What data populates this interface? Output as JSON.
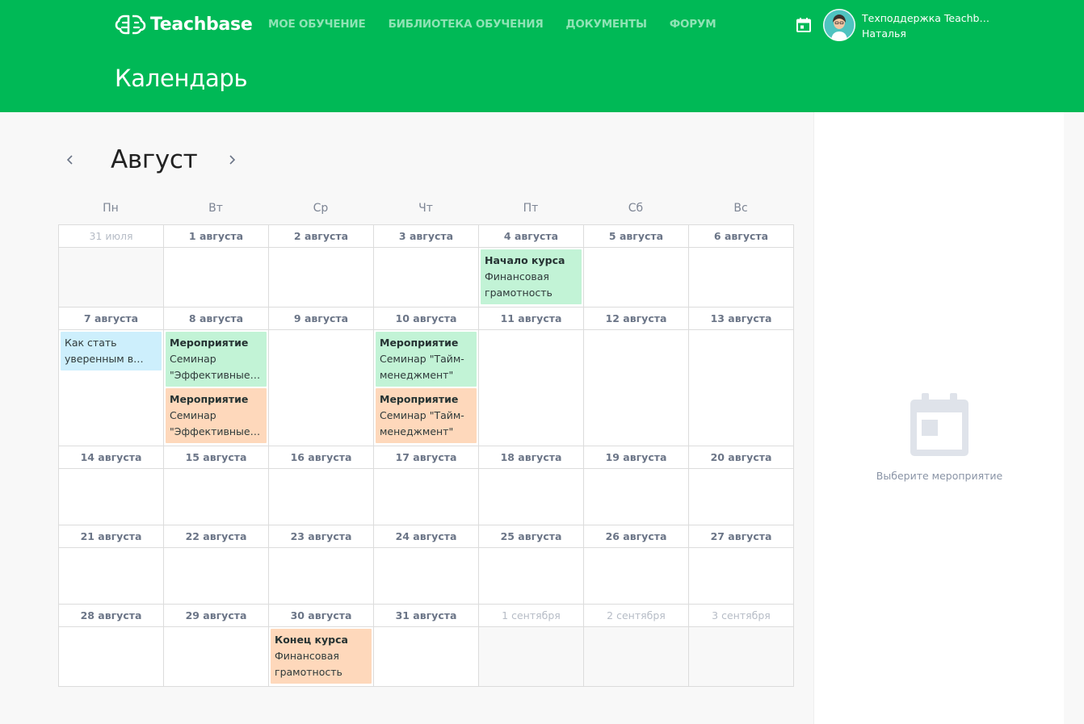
{
  "app": {
    "logo_text": "Teachbase",
    "brand_color": "#00b956"
  },
  "nav": [
    {
      "label": "МОЕ ОБУЧЕНИЕ"
    },
    {
      "label": "БИБЛИОТЕКА ОБУЧЕНИЯ"
    },
    {
      "label": "ДОКУМЕНТЫ"
    },
    {
      "label": "ФОРУМ"
    }
  ],
  "user": {
    "line1": "Техподдержка Teachbase",
    "line2": "Наталья"
  },
  "page": {
    "title": "Календарь"
  },
  "calendar": {
    "month": "Август",
    "weekdays": [
      "Пн",
      "Вт",
      "Ср",
      "Чт",
      "Пт",
      "Сб",
      "Вс"
    ],
    "weeks": [
      {
        "dates": [
          "31 июля",
          "1 августа",
          "2 августа",
          "3 августа",
          "4 августа",
          "5 августа",
          "6 августа"
        ],
        "events": {
          "4": [
            {
              "title": "Начало курса",
              "desc": "Финансовая грамотность",
              "color": "green"
            }
          ]
        }
      },
      {
        "dates": [
          "7 августа",
          "8 августа",
          "9 августа",
          "10 августа",
          "11 августа",
          "12 августа",
          "13 августа"
        ],
        "events": {
          "0": [
            {
              "title": "",
              "desc": "Как стать уверенным в себе",
              "color": "blue"
            }
          ],
          "1": [
            {
              "title": "Мероприятие",
              "desc": "Семинар \"Эффективные переговоры\"",
              "color": "green"
            },
            {
              "title": "Мероприятие",
              "desc": "Семинар \"Эффективные переговоры\"",
              "color": "orange"
            }
          ],
          "3": [
            {
              "title": "Мероприятие",
              "desc": "Семинар \"Тайм-менеджмент\"",
              "color": "green"
            },
            {
              "title": "Мероприятие",
              "desc": "Семинар \"Тайм-менеджмент\"",
              "color": "orange"
            }
          ]
        }
      },
      {
        "dates": [
          "14 августа",
          "15 августа",
          "16 августа",
          "17 августа",
          "18 августа",
          "19 августа",
          "20 августа"
        ],
        "events": {}
      },
      {
        "dates": [
          "21 августа",
          "22 августа",
          "23 августа",
          "24 августа",
          "25 августа",
          "26 августа",
          "27 августа"
        ],
        "events": {}
      },
      {
        "dates": [
          "28 августа",
          "29 августа",
          "30 августа",
          "31 августа",
          "1 сентября",
          "2 сентября",
          "3 сентября"
        ],
        "events": {
          "2": [
            {
              "title": "Конец курса",
              "desc": "Финансовая грамотность",
              "color": "orange"
            }
          ]
        }
      }
    ]
  },
  "sidebar": {
    "empty_text": "Выберите мероприятие"
  }
}
